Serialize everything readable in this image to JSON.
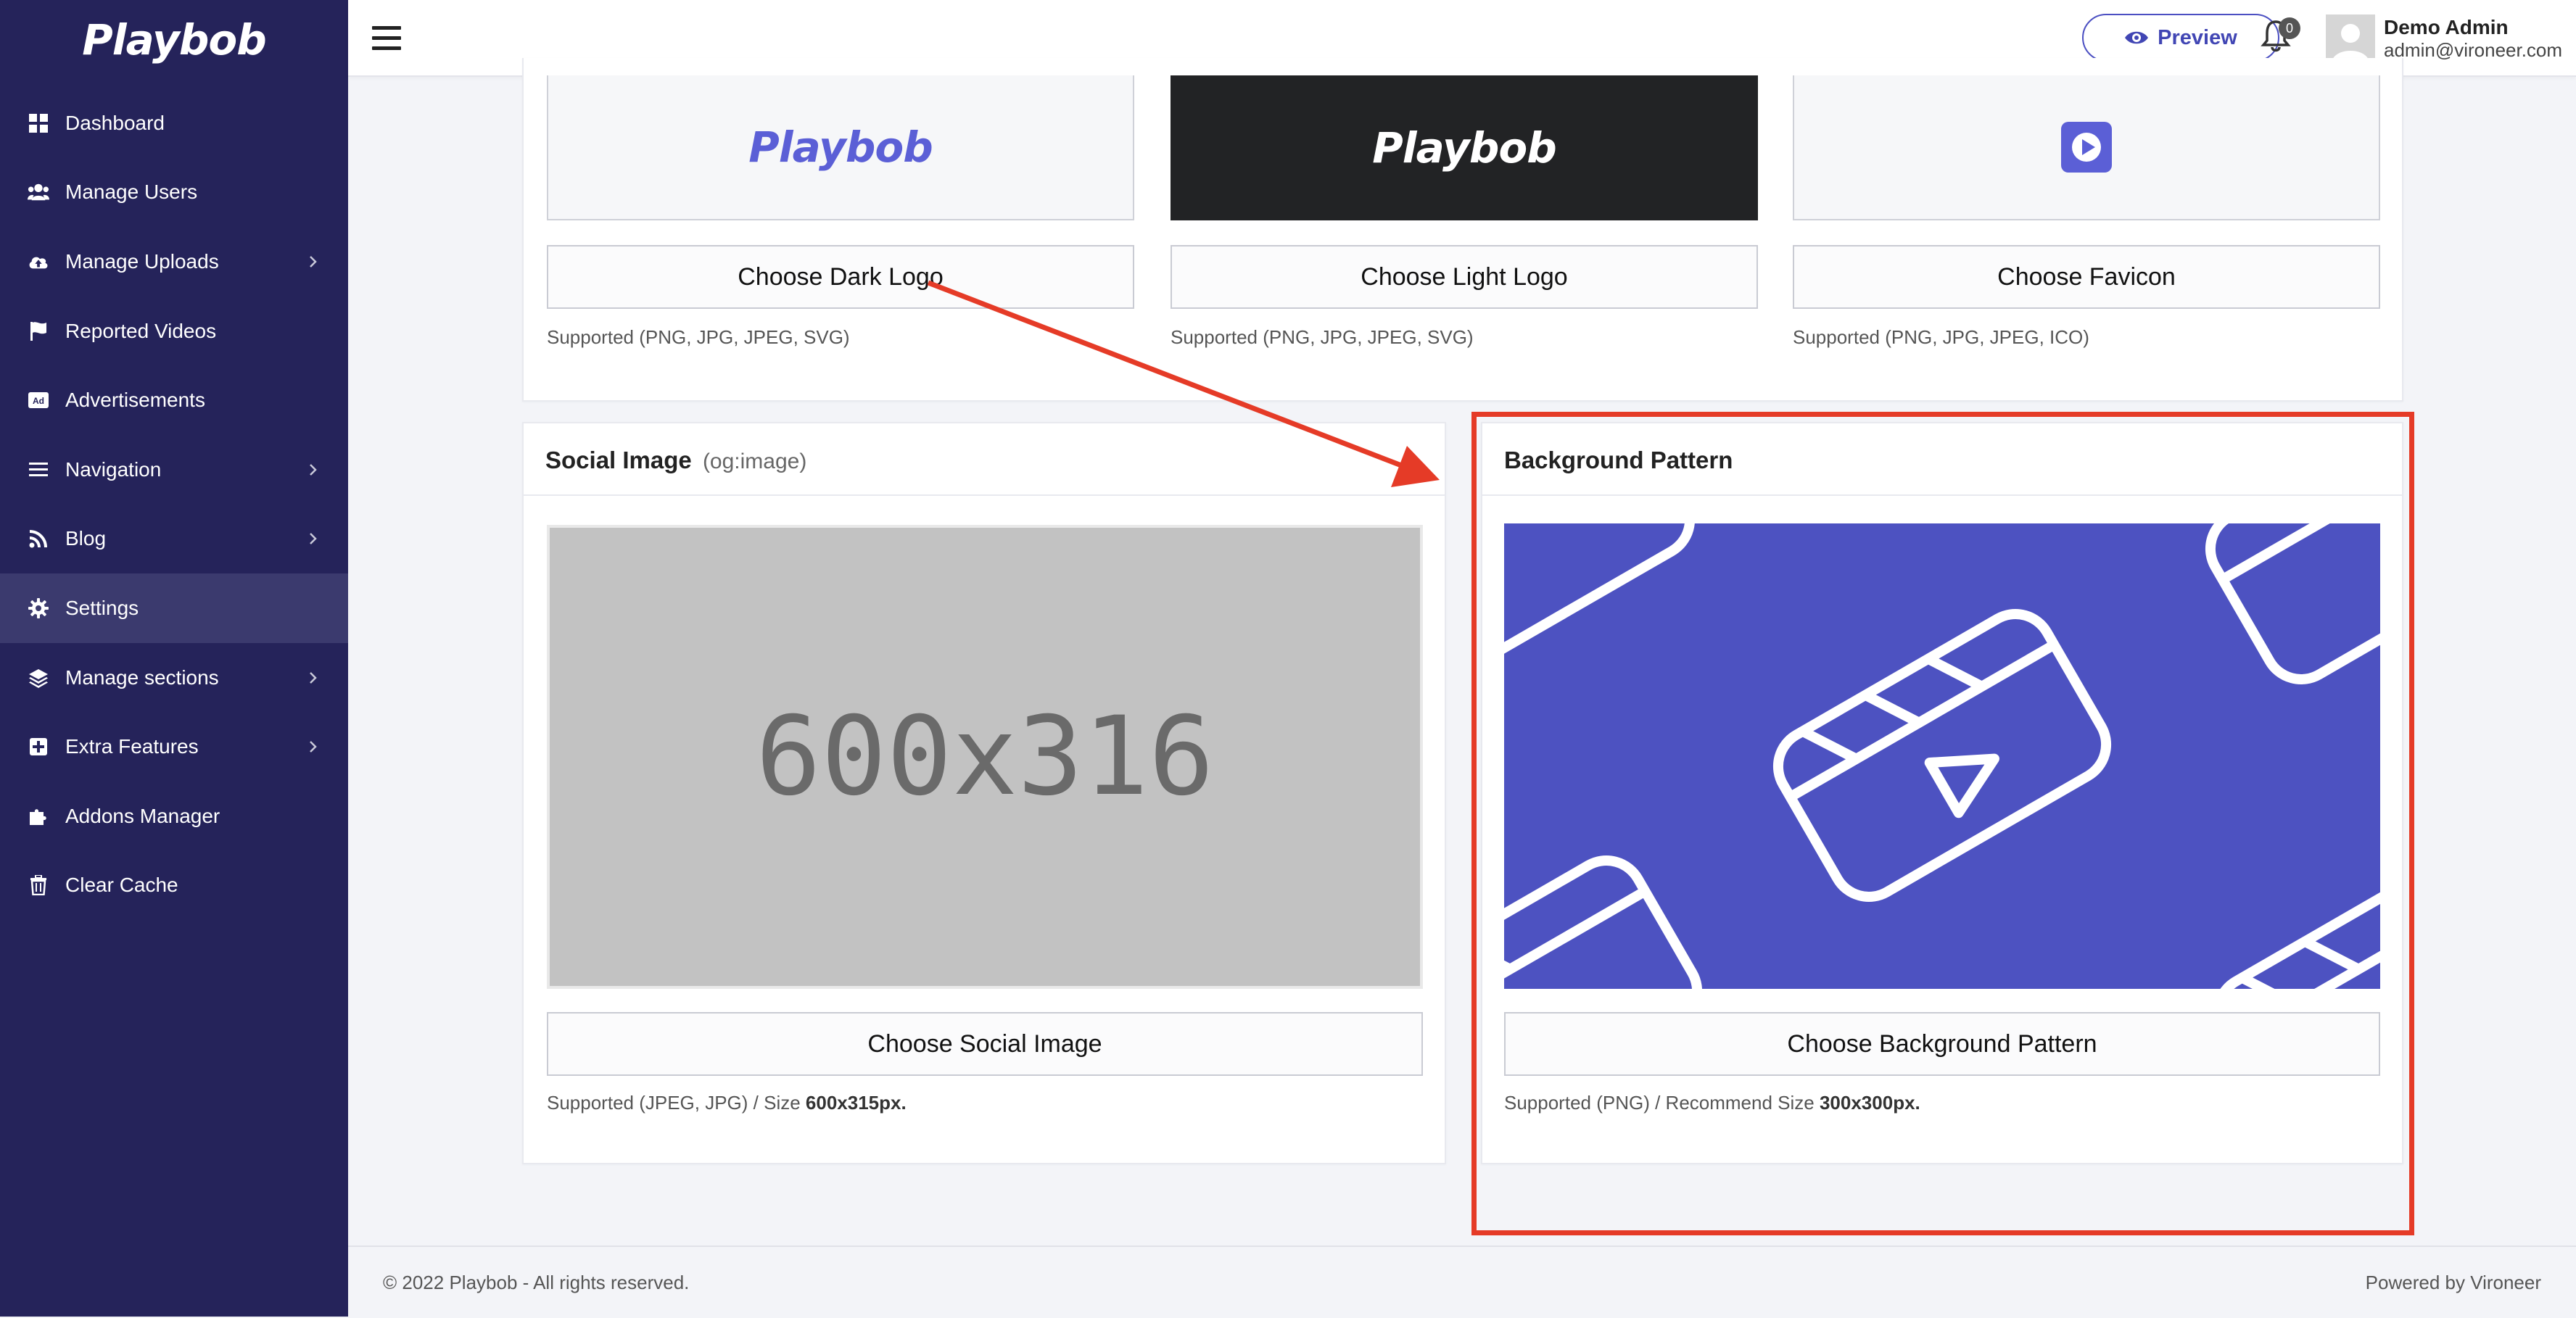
{
  "brand": {
    "name": "Playbob"
  },
  "sidebar": {
    "items": [
      {
        "label": "Dashboard",
        "icon": "dashboard-icon"
      },
      {
        "label": "Manage Users",
        "icon": "users-icon"
      },
      {
        "label": "Manage Uploads",
        "icon": "cloud-upload-icon"
      },
      {
        "label": "Reported Videos",
        "icon": "flag-icon"
      },
      {
        "label": "Advertisements",
        "icon": "ad-icon"
      },
      {
        "label": "Navigation",
        "icon": "list-icon"
      },
      {
        "label": "Blog",
        "icon": "rss-icon"
      },
      {
        "label": "Settings",
        "icon": "gear-icon"
      },
      {
        "label": "Manage sections",
        "icon": "layers-icon"
      },
      {
        "label": "Extra Features",
        "icon": "plus-square-icon"
      },
      {
        "label": "Addons Manager",
        "icon": "puzzle-icon"
      },
      {
        "label": "Clear Cache",
        "icon": "trash-icon"
      }
    ],
    "active": "Settings"
  },
  "header": {
    "preview_label": "Preview",
    "notifications_count": "0",
    "user_name": "Demo Admin",
    "user_email": "admin@vironeer.com"
  },
  "logos": {
    "dark_logo_text": "Playbob",
    "light_logo_text": "Playbob",
    "choose_dark": "Choose Dark Logo",
    "choose_light": "Choose Light Logo",
    "choose_favicon": "Choose Favicon",
    "dark_help": "Supported (PNG, JPG, JPEG, SVG)",
    "light_help": "Supported (PNG, JPG, JPEG, SVG)",
    "favicon_help": "Supported (PNG, JPG, JPEG, ICO)"
  },
  "social": {
    "title": "Social Image",
    "title_note": "(og:image)",
    "placeholder": "600x316",
    "button": "Choose Social Image",
    "help_prefix": "Supported (JPEG, JPG) / Size ",
    "help_size": "600x315px."
  },
  "background": {
    "title": "Background Pattern",
    "button": "Choose Background Pattern",
    "help_prefix": "Supported (PNG) / Recommend Size ",
    "help_size": "300x300px."
  },
  "footer": {
    "copyright": "© 2022 Playbob - All rights reserved.",
    "powered": "Powered by Vironeer"
  },
  "colors": {
    "sidebar_bg": "#25235a",
    "accent": "#4b4fc2",
    "pattern_bg": "#4d52c1",
    "annotation_red": "#e53b27"
  }
}
